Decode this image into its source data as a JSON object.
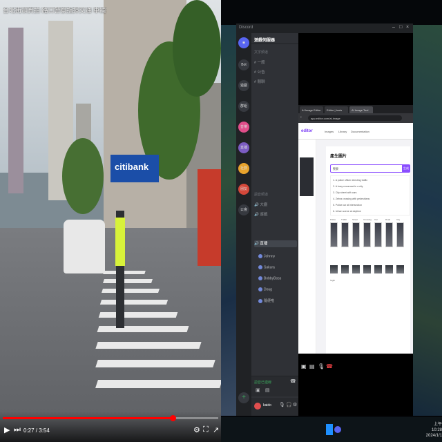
{
  "video": {
    "title": "台北街頭實拍 路口警察指揮交通 車輛行人通過路口",
    "bank_sign": "citibank",
    "time_display": "0:27 / 3:54",
    "progress": 0.79,
    "icons": [
      "play-icon",
      "skip-next-icon",
      "volume-icon",
      "settings-icon",
      "fullscreen-icon",
      "share-icon"
    ]
  },
  "discord": {
    "app_name": "Discord",
    "server_name": "遊戲伺服器",
    "channels": [
      {
        "label": "文字頻道",
        "type": "category"
      },
      {
        "label": "# 一般",
        "type": "text"
      },
      {
        "label": "# 公告",
        "type": "text"
      },
      {
        "label": "# 閒聊",
        "type": "text"
      },
      {
        "label": "語音頻道",
        "type": "category"
      },
      {
        "label": "🔊 大廳",
        "type": "voice"
      },
      {
        "label": "🔊 遊戲",
        "type": "voice"
      },
      {
        "label": "🔊 直播",
        "type": "voice",
        "active": true
      }
    ],
    "voice_users": [
      "Johnny",
      "Sakura",
      "BobbyBoss",
      "Doug",
      "隨便啦"
    ],
    "voice_status": "語音已連線",
    "user_name": "kaido",
    "servers": [
      "Bot",
      "遊戲",
      "群組",
      "音樂",
      "直播",
      "社群",
      "朋友",
      "公會",
      "+"
    ]
  },
  "browser": {
    "tabs": [
      "AI Image Editor",
      "Editor | tools",
      "AI Image Tool"
    ],
    "url": "app.editor.com/ai-image",
    "site_logo": "editor",
    "nav_items": [
      "Images",
      "Library",
      "Documentation"
    ],
    "card_title": "產生圖片",
    "prompt_value": "警察",
    "go_label": "生成",
    "prompt_lines": [
      "1. A police officer directing traffic",
      "2. A busy crossroad in a city",
      "3. City street with cars",
      "4. Zebra crossing with pedestrians",
      "5. Police car at intersection",
      "6. Urban scene at daytime"
    ],
    "thumb_labels": [
      "Police",
      "Traffic",
      "Street",
      "Crossing",
      "Car",
      "Road",
      "City",
      "Night"
    ]
  },
  "taskbar": {
    "time": "上午 10:28",
    "date": "2024/1/1"
  },
  "colors": {
    "discord_dark": "#202225",
    "discord_panel": "#2f3136",
    "accent_purple": "#8a4dff",
    "progress_red": "#ff0000"
  }
}
